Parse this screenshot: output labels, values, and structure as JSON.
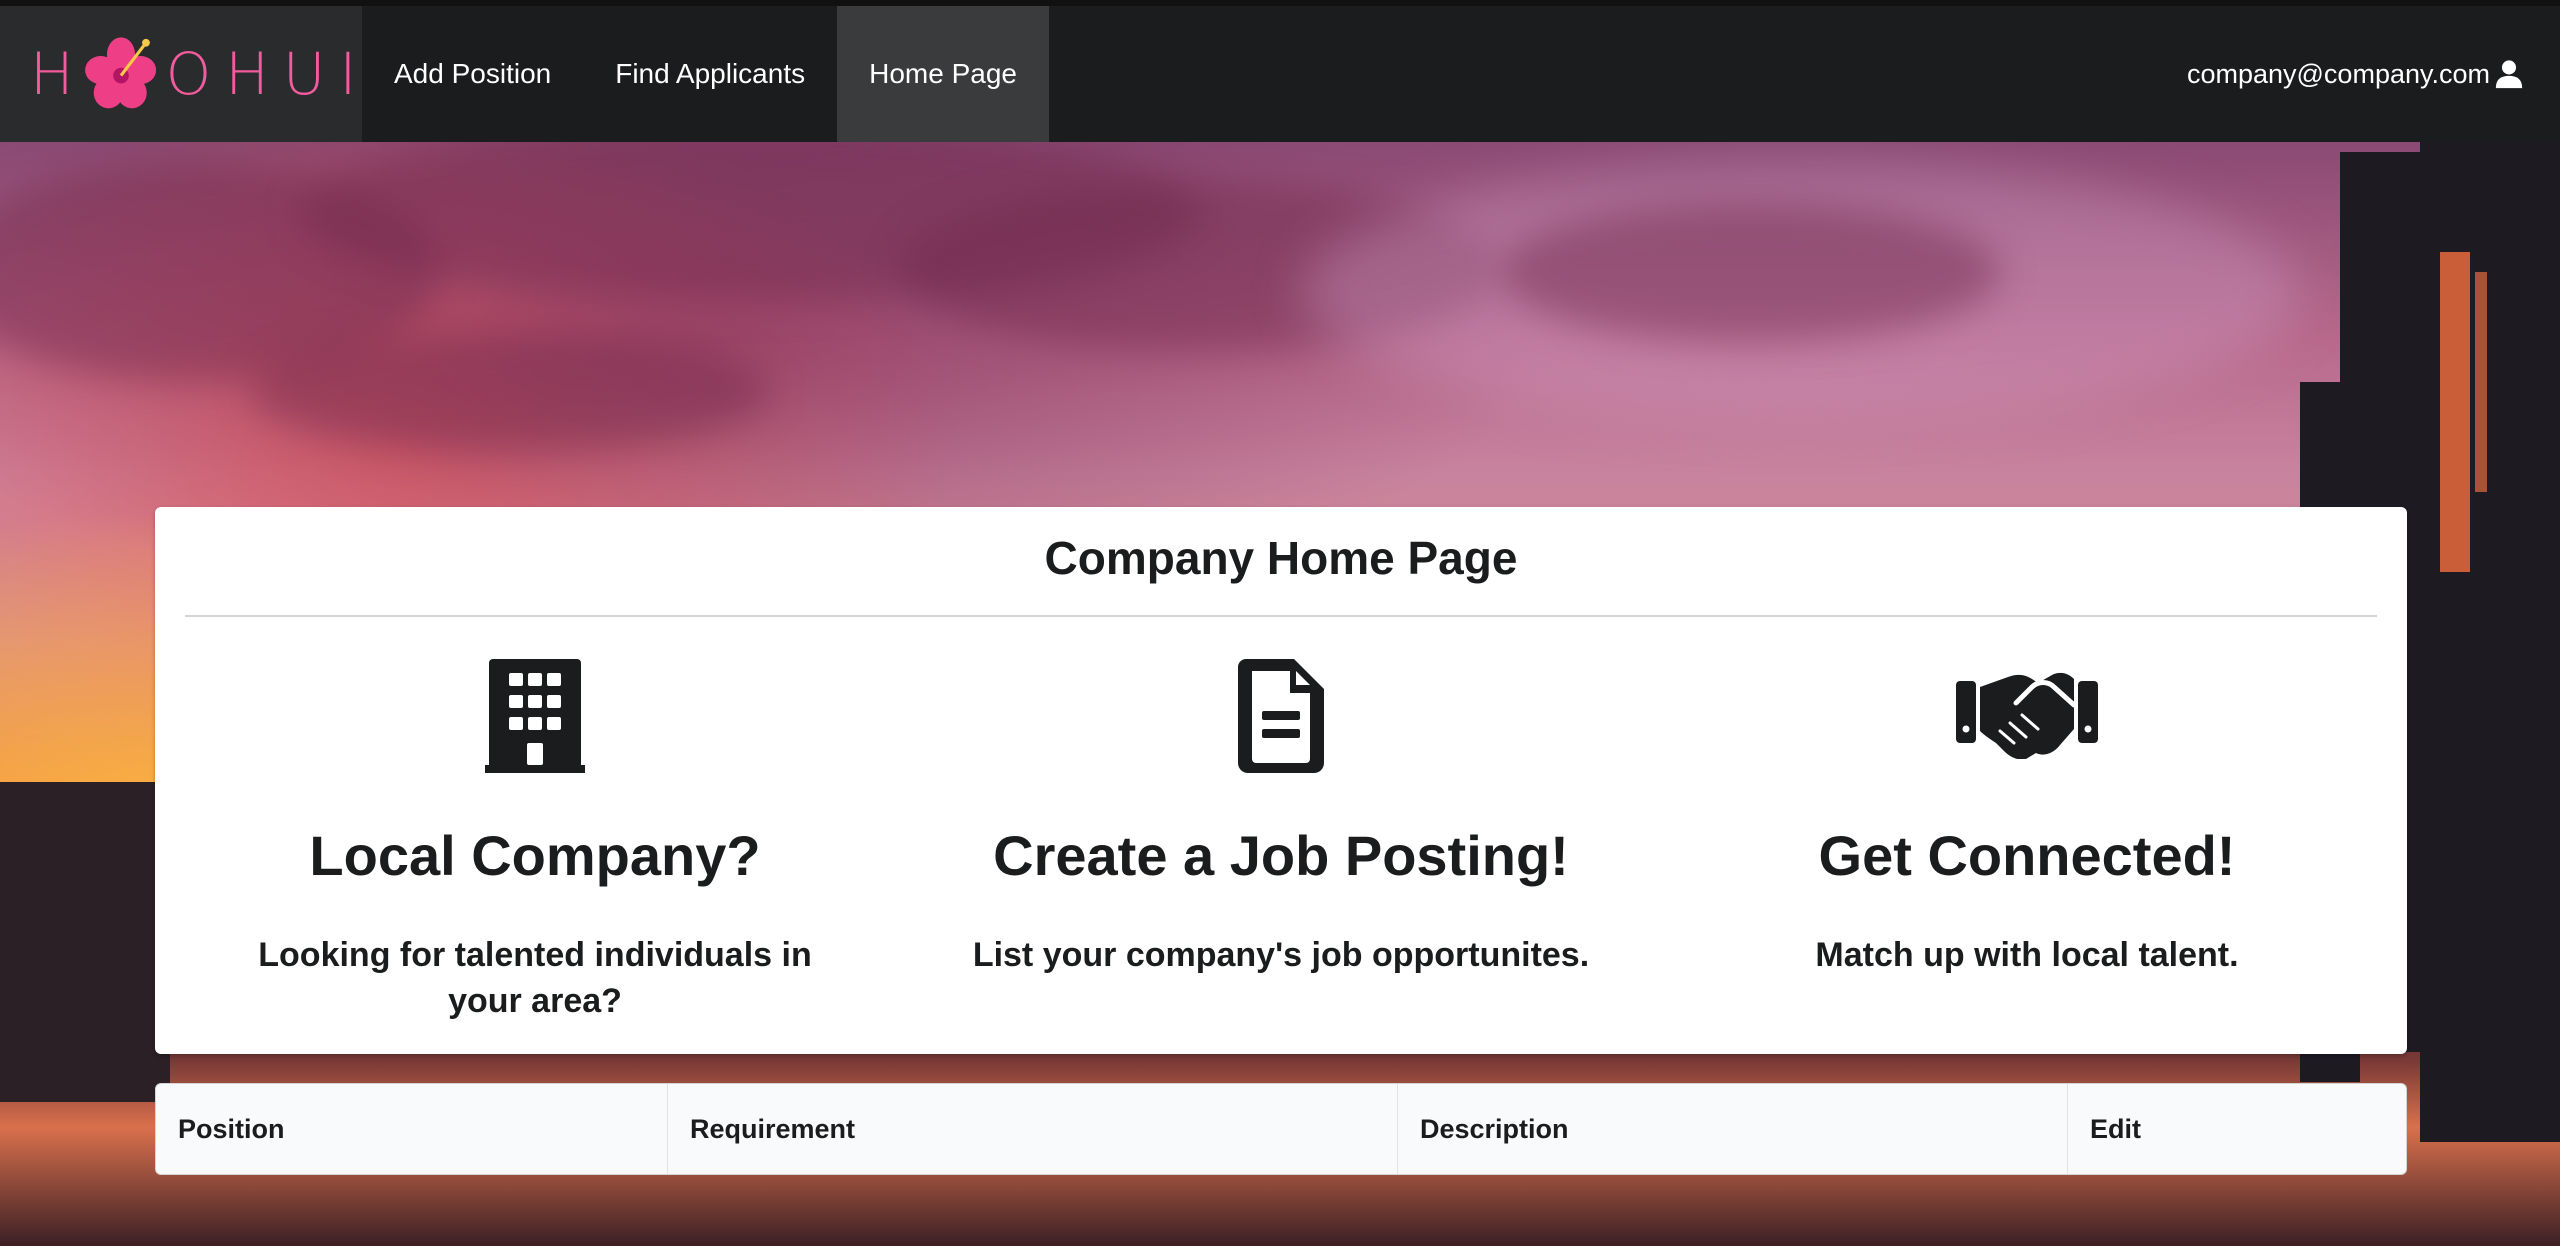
{
  "nav": {
    "logo_text_left": "H",
    "logo_text_right": "OHUI",
    "items": [
      {
        "label": "Add Position"
      },
      {
        "label": "Find Applicants"
      },
      {
        "label": "Home Page",
        "active": true
      }
    ],
    "user_email": "company@company.com",
    "user_icon": "user-icon"
  },
  "card": {
    "title": "Company Home Page",
    "features": [
      {
        "icon": "building-icon",
        "heading": "Local Company?",
        "text": "Looking for talented individuals in your area?"
      },
      {
        "icon": "file-icon",
        "heading": "Create a Job Posting!",
        "text": "List your company's job opportunites."
      },
      {
        "icon": "handshake-icon",
        "heading": "Get Connected!",
        "text": "Match up with local talent."
      }
    ]
  },
  "table": {
    "headers": [
      "Position",
      "Requirement",
      "Description",
      "Edit"
    ]
  },
  "colors": {
    "navbar": "#1b1c1d",
    "logo_pink": "#f45b9e",
    "active_nav": "#3a3b3c",
    "card_bg": "#ffffff",
    "table_header_bg": "#f9fafb"
  }
}
